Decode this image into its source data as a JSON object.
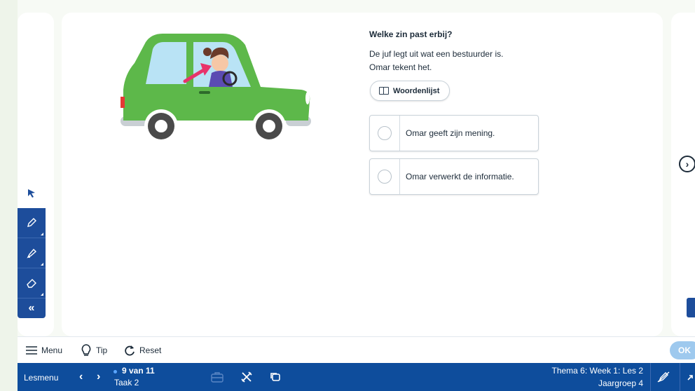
{
  "question": {
    "title": "Welke zin past erbij?",
    "line1": "De juf legt uit wat een bestuurder is.",
    "line2": "Omar tekent het.",
    "wordlist_label": "Woordenlijst"
  },
  "options": [
    {
      "label": "Omar geeft zijn mening."
    },
    {
      "label": "Omar verwerkt de informatie."
    }
  ],
  "nav": {
    "next_glyph": "›"
  },
  "tools": {
    "collapse_glyph": "«"
  },
  "bottombar": {
    "menu_label": "Menu",
    "tip_label": "Tip",
    "reset_label": "Reset",
    "ok_label": "OK"
  },
  "statusbar": {
    "lesmenu_label": "Lesmenu",
    "progress": "9 van 11",
    "task": "Taak 2",
    "lesson": "Thema 6: Week 1: Les 2",
    "group": "Jaargroep 4"
  },
  "colors": {
    "brand_blue": "#0e4d9c",
    "car_green": "#5db84a",
    "ok_button": "#9ec9ee",
    "arrow_pink": "#e8336b"
  }
}
